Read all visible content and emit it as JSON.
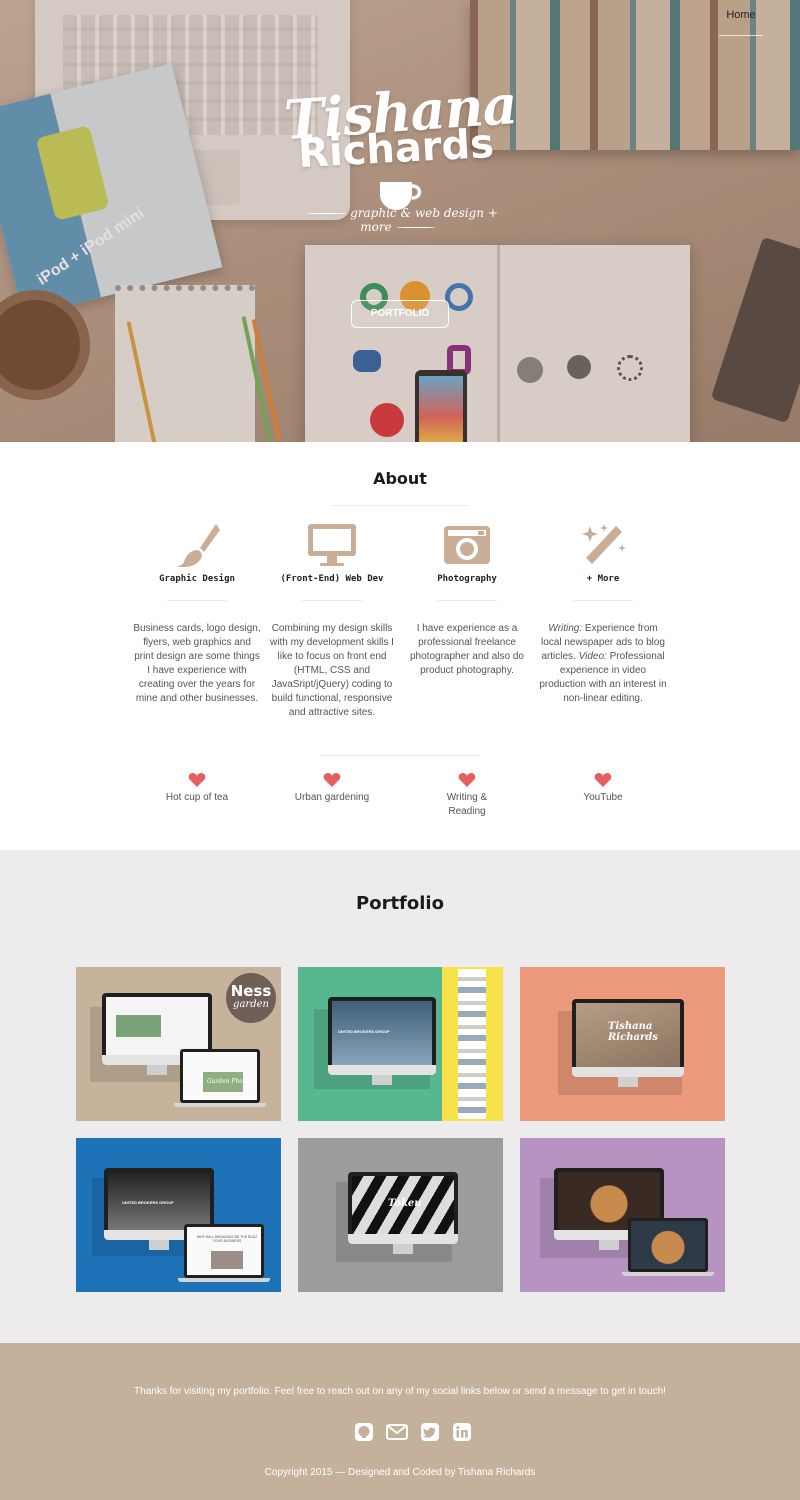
{
  "nav": {
    "home_label": "Home"
  },
  "hero": {
    "name_first": "Tishana",
    "name_last": "Richards",
    "tagline": "graphic & web design + more",
    "portfolio_button": "PORTFOLIO",
    "brochure_text": "iPod + iPod mini"
  },
  "about": {
    "title": "About",
    "skills": [
      {
        "name": "Graphic Design",
        "icon": "paintbrush-icon",
        "desc": "Business cards, logo design, flyers, web graphics and print design are some things I have experience with creating over the years for mine and other businesses."
      },
      {
        "name": "(Front-End) Web Dev",
        "icon": "monitor-icon",
        "desc": "Combining my design skills with my development skills I like to focus on front end (HTML, CSS and JavaSript/jQuery) coding to build functional, responsive and attractive sites."
      },
      {
        "name": "Photography",
        "icon": "camera-icon",
        "desc": "I have experience as a professional freelance photographer and also do product photography."
      },
      {
        "name": "+ More",
        "icon": "magic-wand-icon",
        "desc_writing_label": "Writing:",
        "desc_writing": " Experience from local newspaper ads to blog articles.",
        "desc_video_label": "Video:",
        "desc_video": " Professional experience in video production with an interest in non-linear editing."
      }
    ],
    "hobbies": [
      "Hot cup of tea",
      "Urban gardening",
      "Writing & Reading",
      "YouTube"
    ]
  },
  "portfolio": {
    "title": "Portfolio",
    "tiles": [
      {
        "name": "ness-garden",
        "bg": "#c7b39b",
        "badge_line1": "Ness",
        "badge_line2": "garden",
        "screen_text": "Garden Photos"
      },
      {
        "name": "united-brokers",
        "bg": "#57b890",
        "screen_text": "UNITED BROKERS GROUP"
      },
      {
        "name": "tishana-richards",
        "bg": "#ec9a7c",
        "screen_text": "Tishana Richards"
      },
      {
        "name": "ubg-blue",
        "bg": "#1e73b8",
        "screen_text": "UNITED BROKERS GROUP",
        "lap_text": "WHY WILL ARKANSAS BE THE BUZZ YOUR BUSINESS"
      },
      {
        "name": "token",
        "bg": "#9c9c9c",
        "screen_text": "Token"
      },
      {
        "name": "food-site",
        "bg": "#b693c1",
        "screen_text": ""
      }
    ]
  },
  "footer": {
    "message": "Thanks for visiting my portfolio. Feel free to reach out on any of my social links below or send a message to get in touch!",
    "social": [
      "github-icon",
      "mail-icon",
      "twitter-icon",
      "linkedin-icon"
    ],
    "copyright": "Copyright 2015 — Designed and Coded by Tishana Richards"
  },
  "colors": {
    "accent_brown": "#c4b19c",
    "heart_red": "#e4605e",
    "icon_tan": "#c9ad96"
  }
}
